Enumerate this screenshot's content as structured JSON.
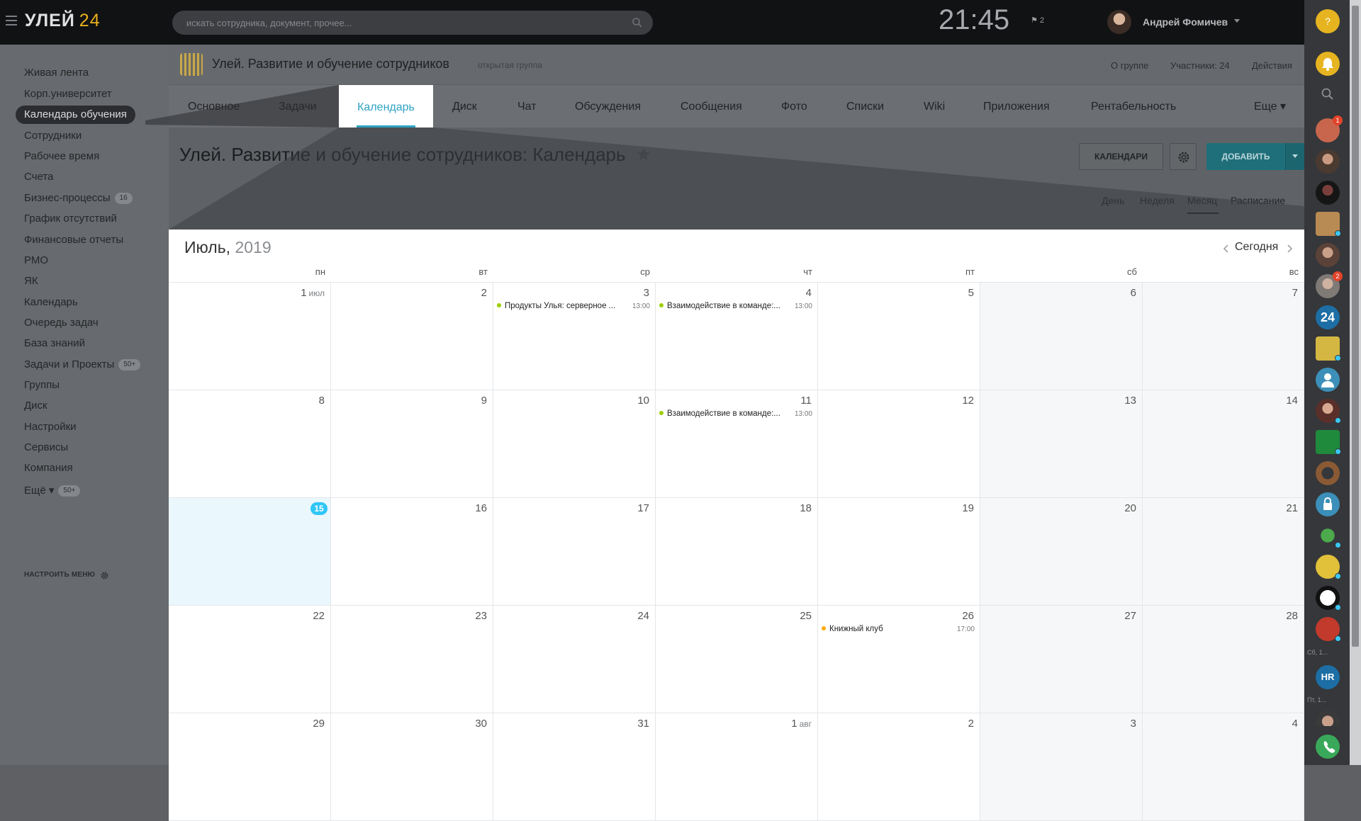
{
  "topbar": {
    "logo": "УЛЕЙ",
    "logo_num": "24",
    "search_placeholder": "искать сотрудника, документ, прочее...",
    "clock": "21:45",
    "flag_count": "2",
    "user_name": "Андрей Фомичев"
  },
  "leftmenu": {
    "items": [
      {
        "label": "Живая лента"
      },
      {
        "label": "Корп.университет"
      },
      {
        "label": "Календарь обучения",
        "active": true
      },
      {
        "label": "Сотрудники"
      },
      {
        "label": "Рабочее время"
      },
      {
        "label": "Счета"
      },
      {
        "label": "Бизнес-процессы",
        "counter": "16"
      },
      {
        "label": "График отсутствий"
      },
      {
        "label": "Финансовые отчеты"
      },
      {
        "label": "РМО"
      },
      {
        "label": "ЯК"
      },
      {
        "label": "Календарь"
      },
      {
        "label": "Очередь задач"
      },
      {
        "label": "База знаний"
      },
      {
        "label": "Задачи и Проекты",
        "counter": "50+"
      },
      {
        "label": "Группы"
      },
      {
        "label": "Диск"
      },
      {
        "label": "Настройки"
      },
      {
        "label": "Сервисы"
      },
      {
        "label": "Компания"
      },
      {
        "label": "Ещё ▾",
        "counter": "50+"
      }
    ],
    "configure": "НАСТРОИТЬ МЕНЮ"
  },
  "group": {
    "title": "Улей. Развитие и обучение сотрудников",
    "type": "открытая группа",
    "about": "О группе",
    "members": "Участники: 24",
    "actions": "Действия"
  },
  "tabs": {
    "items": [
      "Основное",
      "Задачи",
      "Календарь",
      "Диск",
      "Чат",
      "Обсуждения",
      "Сообщения",
      "Фото",
      "Списки",
      "Wiki",
      "Приложения",
      "Рентабельность",
      "Еще ▾"
    ],
    "active": "Календарь"
  },
  "page": {
    "title": "Улей. Развитие и обучение сотрудников: Календарь",
    "btn_calendars": "КАЛЕНДАРИ",
    "btn_add": "ДОБАВИТЬ",
    "views": [
      "День",
      "Неделя",
      "Месяц",
      "Расписание"
    ],
    "active_view": "Месяц"
  },
  "calendar": {
    "month": "Июль,",
    "year": "2019",
    "today_label": "Сегодня",
    "weekdays": [
      "пн",
      "вт",
      "ср",
      "чт",
      "пт",
      "сб",
      "вс"
    ],
    "weeks": [
      [
        {
          "d": "1",
          "suffix": "июл"
        },
        {
          "d": "2"
        },
        {
          "d": "3"
        },
        {
          "d": "4"
        },
        {
          "d": "5"
        },
        {
          "d": "6"
        },
        {
          "d": "7"
        }
      ],
      [
        {
          "d": "8"
        },
        {
          "d": "9"
        },
        {
          "d": "10"
        },
        {
          "d": "11"
        },
        {
          "d": "12"
        },
        {
          "d": "13"
        },
        {
          "d": "14"
        }
      ],
      [
        {
          "d": "15",
          "today": true
        },
        {
          "d": "16"
        },
        {
          "d": "17"
        },
        {
          "d": "18"
        },
        {
          "d": "19"
        },
        {
          "d": "20"
        },
        {
          "d": "21"
        }
      ],
      [
        {
          "d": "22"
        },
        {
          "d": "23"
        },
        {
          "d": "24"
        },
        {
          "d": "25"
        },
        {
          "d": "26"
        },
        {
          "d": "27"
        },
        {
          "d": "28"
        }
      ],
      [
        {
          "d": "29"
        },
        {
          "d": "30"
        },
        {
          "d": "31"
        },
        {
          "d": "1",
          "suffix": "авг"
        },
        {
          "d": "2"
        },
        {
          "d": "3"
        },
        {
          "d": "4"
        }
      ]
    ],
    "events": [
      {
        "week": 0,
        "day": 2,
        "title": "Продукты Улья: серверное ...",
        "time": "13:00",
        "color": "#9dcf00"
      },
      {
        "week": 0,
        "day": 3,
        "title": "Взаимодействие в команде:...",
        "time": "13:00",
        "color": "#9dcf00"
      },
      {
        "week": 1,
        "day": 3,
        "title": "Взаимодействие в команде:...",
        "time": "13:00",
        "color": "#9dcf00"
      },
      {
        "week": 3,
        "day": 4,
        "title": "Книжный клуб",
        "time": "17:00",
        "color": "#ffa900"
      }
    ]
  },
  "rightbar": {
    "labels": [
      "Сб, 1...",
      "Пт, 1..."
    ],
    "badges": [
      "1",
      "2"
    ],
    "text_avatars": [
      "24",
      "HR"
    ]
  },
  "colors": {
    "accent": "#2fa3c4",
    "add_button": "#1f6f7a",
    "today_badge": "#2fc6f6",
    "event_green": "#9dcf00",
    "event_orange": "#ffa900"
  }
}
